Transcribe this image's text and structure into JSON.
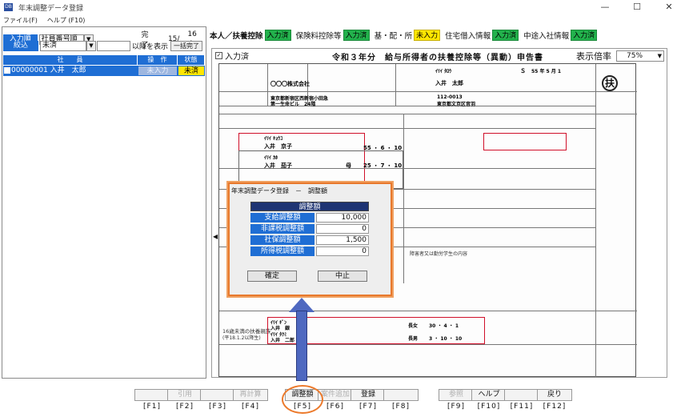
{
  "window": {
    "title": "年末調整データ登録",
    "icon_text": "DB"
  },
  "menu": [
    "ファイル(F)",
    "ヘルプ (F10)"
  ],
  "left": {
    "input_order_label": "入力順",
    "input_order_value": "社員番号順",
    "done_label": "完了",
    "done_value": "15/",
    "total_value": "16 人",
    "filter_label": "絞込",
    "filter_value": "未済",
    "show_after_label": "以降を表示",
    "bulk_complete_label": "一括完了",
    "columns": [
      "社　　員",
      "操　作",
      "状態"
    ],
    "rows": [
      {
        "checked": false,
        "employee": "00000001 入井　太郎",
        "action": "未入力",
        "status": "未済"
      }
    ]
  },
  "tabs": [
    {
      "label": "本人／扶養控除",
      "status": "入力済",
      "status_color": "green",
      "bold": true
    },
    {
      "label": "保険料控除等",
      "status": "入力済",
      "status_color": "green",
      "bold": false
    },
    {
      "label": "基・配・所",
      "status": "未入力",
      "status_color": "yellow",
      "bold": false
    },
    {
      "label": "住宅借入情報",
      "status": "入力済",
      "status_color": "green",
      "bold": false
    },
    {
      "label": "中途入社情報",
      "status": "入力済",
      "status_color": "green",
      "bold": false
    }
  ],
  "form": {
    "entered_checkbox_label": "入力済",
    "form_title": "令和３年分　給与所得者の扶養控除等（異動）申告書",
    "zoom_label": "表示倍率",
    "zoom_value": "75%",
    "fu_mark": "扶",
    "company_name": "〇〇〇株式会社",
    "company_address_1": "東京都新宿区西新宿小田急",
    "company_address_2": "第一生命ビル　24階",
    "employee_kana": "ｲﾘｲ ﾀﾛｳ",
    "employee_name": "入井　太郎",
    "birth_era": "Ｓ",
    "birth_rest": "55 年 5 月 1",
    "postal": "112-0013",
    "address": "東京都文京区音羽",
    "spouse_kana": "ｲﾘｲ ｷｮｳｺ",
    "spouse_name": "入井　京子",
    "spouse_birth": "55 ・ 6 ・ 10",
    "dep1_kana": "ｲﾘｲ ｶﾎ",
    "dep1_name": "入井　茄子",
    "dep1_relation": "母",
    "dep1_birth": "25 ・ 7 ・ 10",
    "child_section": "16歳未満の扶養親族",
    "child_note": "(平18.1.2以降生)",
    "child1_kana": "ｲﾘｲ ｷﾞﾝ",
    "child1_name": "入井　銀",
    "child1_relation": "長女",
    "child1_birth": "30 ・ 4 ・ 1",
    "child2_kana": "ｲﾘｲ ﾀｸﾐ",
    "child2_name": "入井　二郎",
    "child2_relation": "長男",
    "child2_birth": "3 ・ 10 ・ 10",
    "nonres_label": "障害者又は勤労学生の内容"
  },
  "dialog": {
    "title": "年末調整データ登録　－　調整額",
    "header": "調整額",
    "rows": [
      {
        "label": "支給調整額",
        "value": "10,000"
      },
      {
        "label": "非課税調整額",
        "value": "0"
      },
      {
        "label": "社保調整額",
        "value": "1,500"
      },
      {
        "label": "所得税調整額",
        "value": "0"
      }
    ],
    "ok_label": "確定",
    "cancel_label": "中止"
  },
  "fkeys": [
    {
      "label": "",
      "fn": "[F1]",
      "disabled": true
    },
    {
      "label": "引用",
      "fn": "[F2]",
      "disabled": true
    },
    {
      "label": "",
      "fn": "[F3]",
      "disabled": true
    },
    {
      "label": "再計算",
      "fn": "[F4]",
      "disabled": true
    },
    {
      "label": "調整額",
      "fn": "[F5]",
      "disabled": false
    },
    {
      "label": "案件追加",
      "fn": "[F6]",
      "disabled": true
    },
    {
      "label": "登録",
      "fn": "[F7]",
      "disabled": false
    },
    {
      "label": "",
      "fn": "[F8]",
      "disabled": true
    },
    {
      "label": "参照",
      "fn": "[F9]",
      "disabled": true
    },
    {
      "label": "ヘルプ",
      "fn": "[F10]",
      "disabled": false
    },
    {
      "label": "",
      "fn": "[F11]",
      "disabled": true
    },
    {
      "label": "戻り",
      "fn": "[F12]",
      "disabled": false
    }
  ]
}
